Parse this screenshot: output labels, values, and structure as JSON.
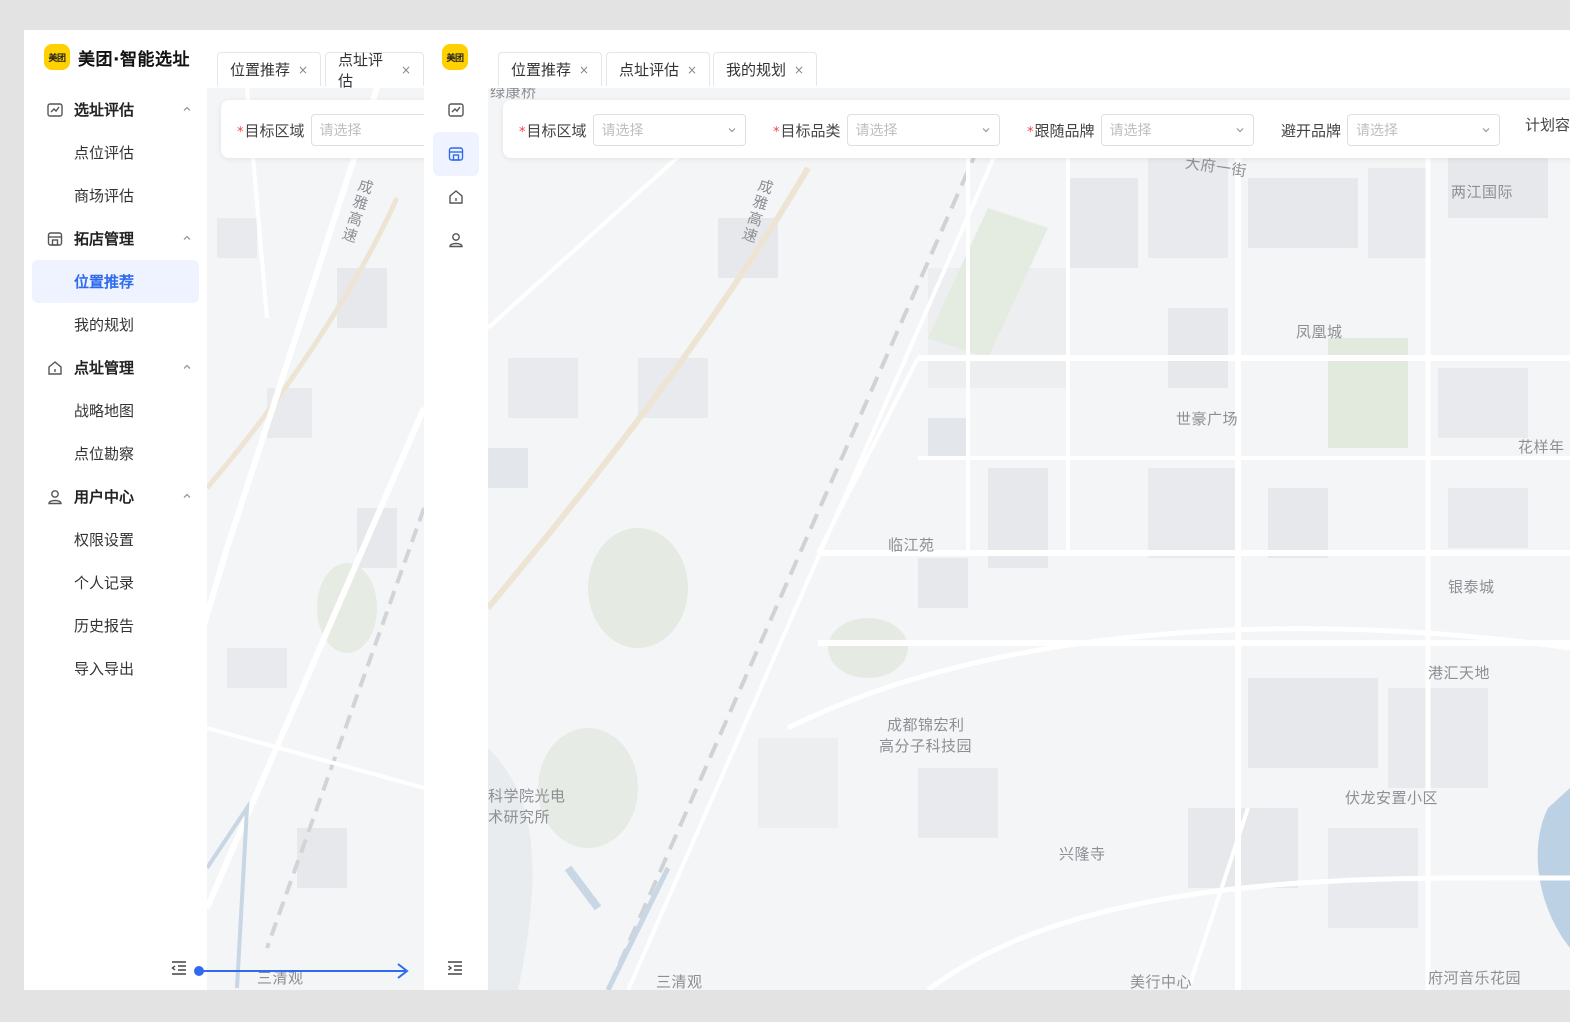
{
  "brand": {
    "logo_badge": "美团",
    "title": "美团·智能选址"
  },
  "sidebar": {
    "groups": [
      {
        "label": "选址评估",
        "icon": "chart-icon",
        "items": [
          "点位评估",
          "商场评估"
        ]
      },
      {
        "label": "拓店管理",
        "icon": "store-icon",
        "items": [
          "位置推荐",
          "我的规划"
        ]
      },
      {
        "label": "点址管理",
        "icon": "home-icon",
        "items": [
          "战略地图",
          "点位勘察"
        ]
      },
      {
        "label": "用户中心",
        "icon": "user-icon",
        "items": [
          "权限设置",
          "个人记录",
          "历史报告",
          "导入导出"
        ]
      }
    ],
    "active_item": "位置推荐"
  },
  "tabs_left": [
    {
      "label": "位置推荐",
      "close": "×"
    },
    {
      "label": "点址评估",
      "close": "×"
    }
  ],
  "tabs_right": [
    {
      "label": "位置推荐",
      "close": "×"
    },
    {
      "label": "点址评估",
      "close": "×"
    },
    {
      "label": "我的规划",
      "close": "×"
    }
  ],
  "filters": {
    "target_area": {
      "label": "目标区域",
      "required": "*",
      "placeholder": "请选择"
    },
    "target_category": {
      "label": "目标品类",
      "required": "*",
      "placeholder": "请选择"
    },
    "follow_brand": {
      "label": "跟随品牌",
      "required": "*",
      "placeholder": "请选择"
    },
    "avoid_brand": {
      "label": "避开品牌",
      "placeholder": "请选择"
    },
    "plan_capacity": {
      "label": "计划容"
    }
  },
  "map_left": {
    "labels": [
      "成雅高速",
      "三清观"
    ]
  },
  "map_right": {
    "labels": [
      "绿康桥",
      "大府一街",
      "两江国际",
      "凤凰城",
      "世豪广场",
      "花样年",
      "临江苑",
      "银泰城",
      "港汇天地",
      "成都锦宏利",
      "高分子科技园",
      "科学院光电",
      "术研究所",
      "伏龙安置小区",
      "兴隆寺",
      "三清观",
      "美行中心",
      "府河音乐花园",
      "成雅高速"
    ]
  },
  "colors": {
    "accent": "#2f6bef",
    "active_bg": "#eef3ff",
    "brand_yellow": "#ffd100",
    "required": "#f53f3f",
    "map_bg": "#f4f5f6"
  }
}
